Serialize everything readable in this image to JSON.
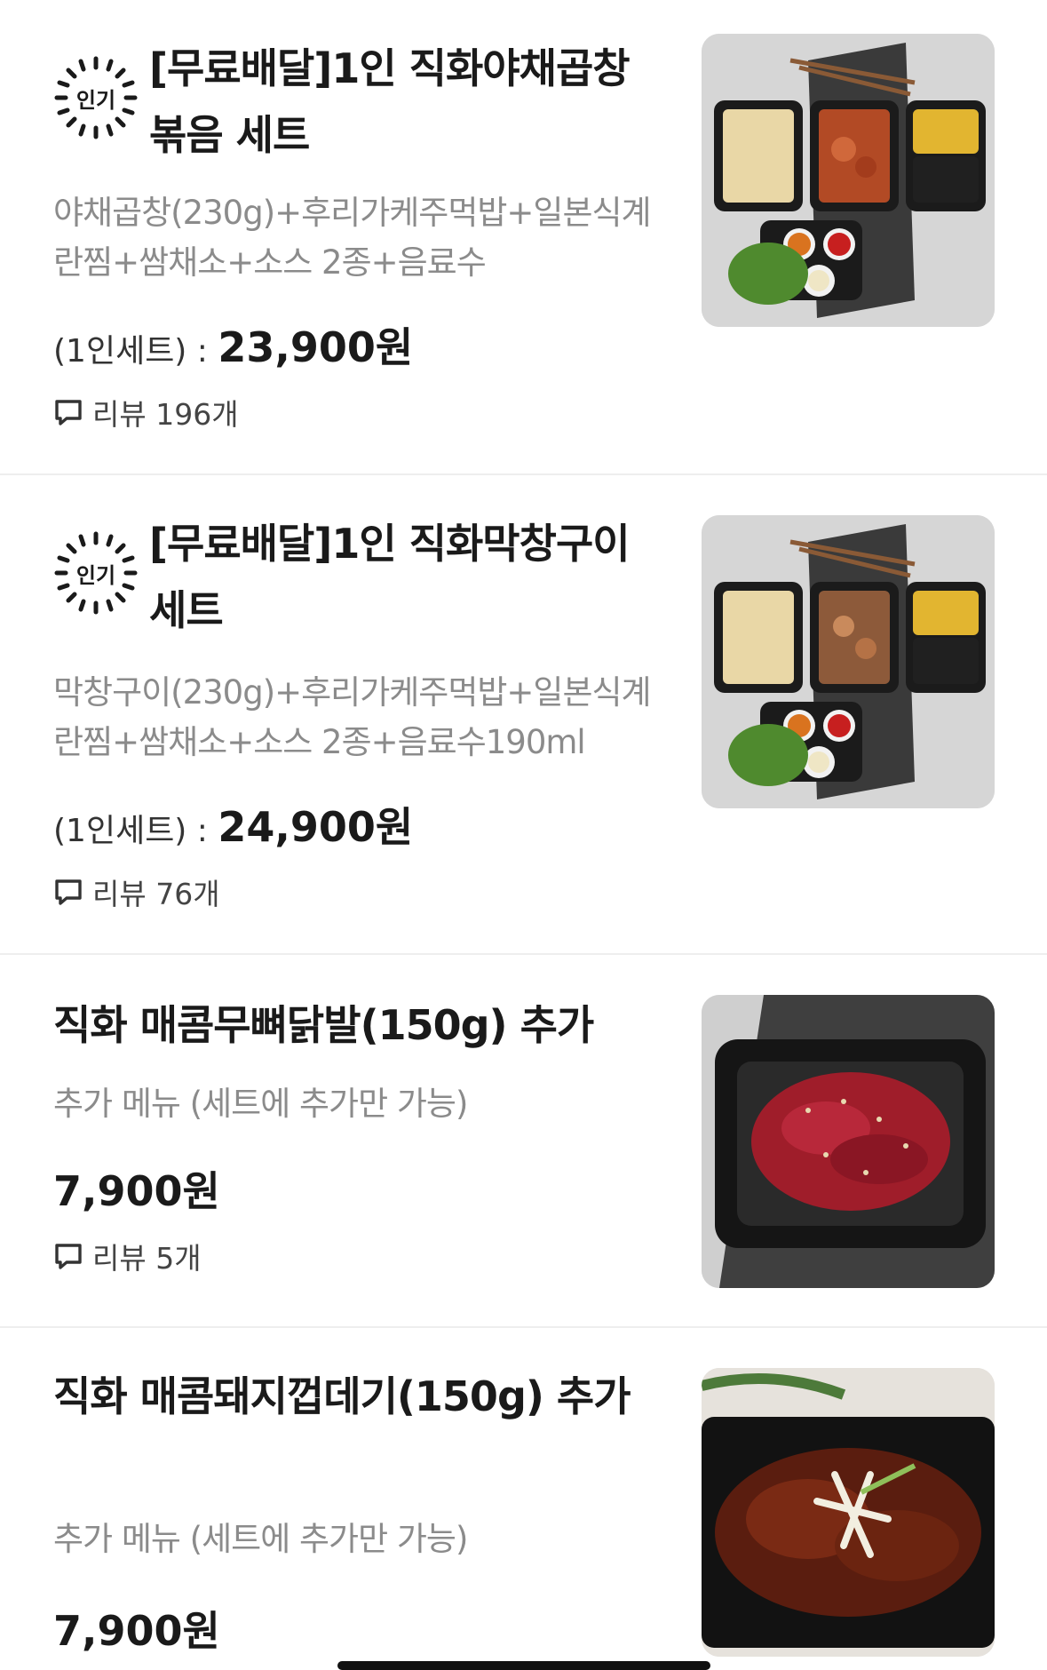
{
  "items": [
    {
      "badge": "인기",
      "title": "[무료배달]1인 직화야채곱창볶음 세트",
      "description": "야채곱창(230g)+후리가케주먹밥+일본식계란찜+쌈채소+소스 2종+음료수",
      "price_prefix": "(1인세트) : ",
      "price": "23,900원",
      "review_label": "리뷰 196개",
      "image": "야채곱창 세트 사진"
    },
    {
      "badge": "인기",
      "title": "[무료배달]1인 직화막창구이 세트",
      "description": "막창구이(230g)+후리가케주먹밥+일본식계란찜+쌈채소+소스 2종+음료수190ml",
      "price_prefix": "(1인세트) : ",
      "price": "24,900원",
      "review_label": "리뷰 76개",
      "image": "막창구이 세트 사진"
    },
    {
      "title": "직화 매콤무뼈닭발(150g) 추가",
      "description": "추가 메뉴 (세트에 추가만 가능)",
      "price": "7,900원",
      "review_label": "리뷰 5개",
      "image": "매콤무뼈닭발 사진"
    },
    {
      "title": "직화 매콤돼지껍데기(150g) 추가",
      "description": "추가 메뉴 (세트에 추가만 가능)",
      "price": "7,900원",
      "image": "매콤돼지껍데기 사진"
    }
  ]
}
